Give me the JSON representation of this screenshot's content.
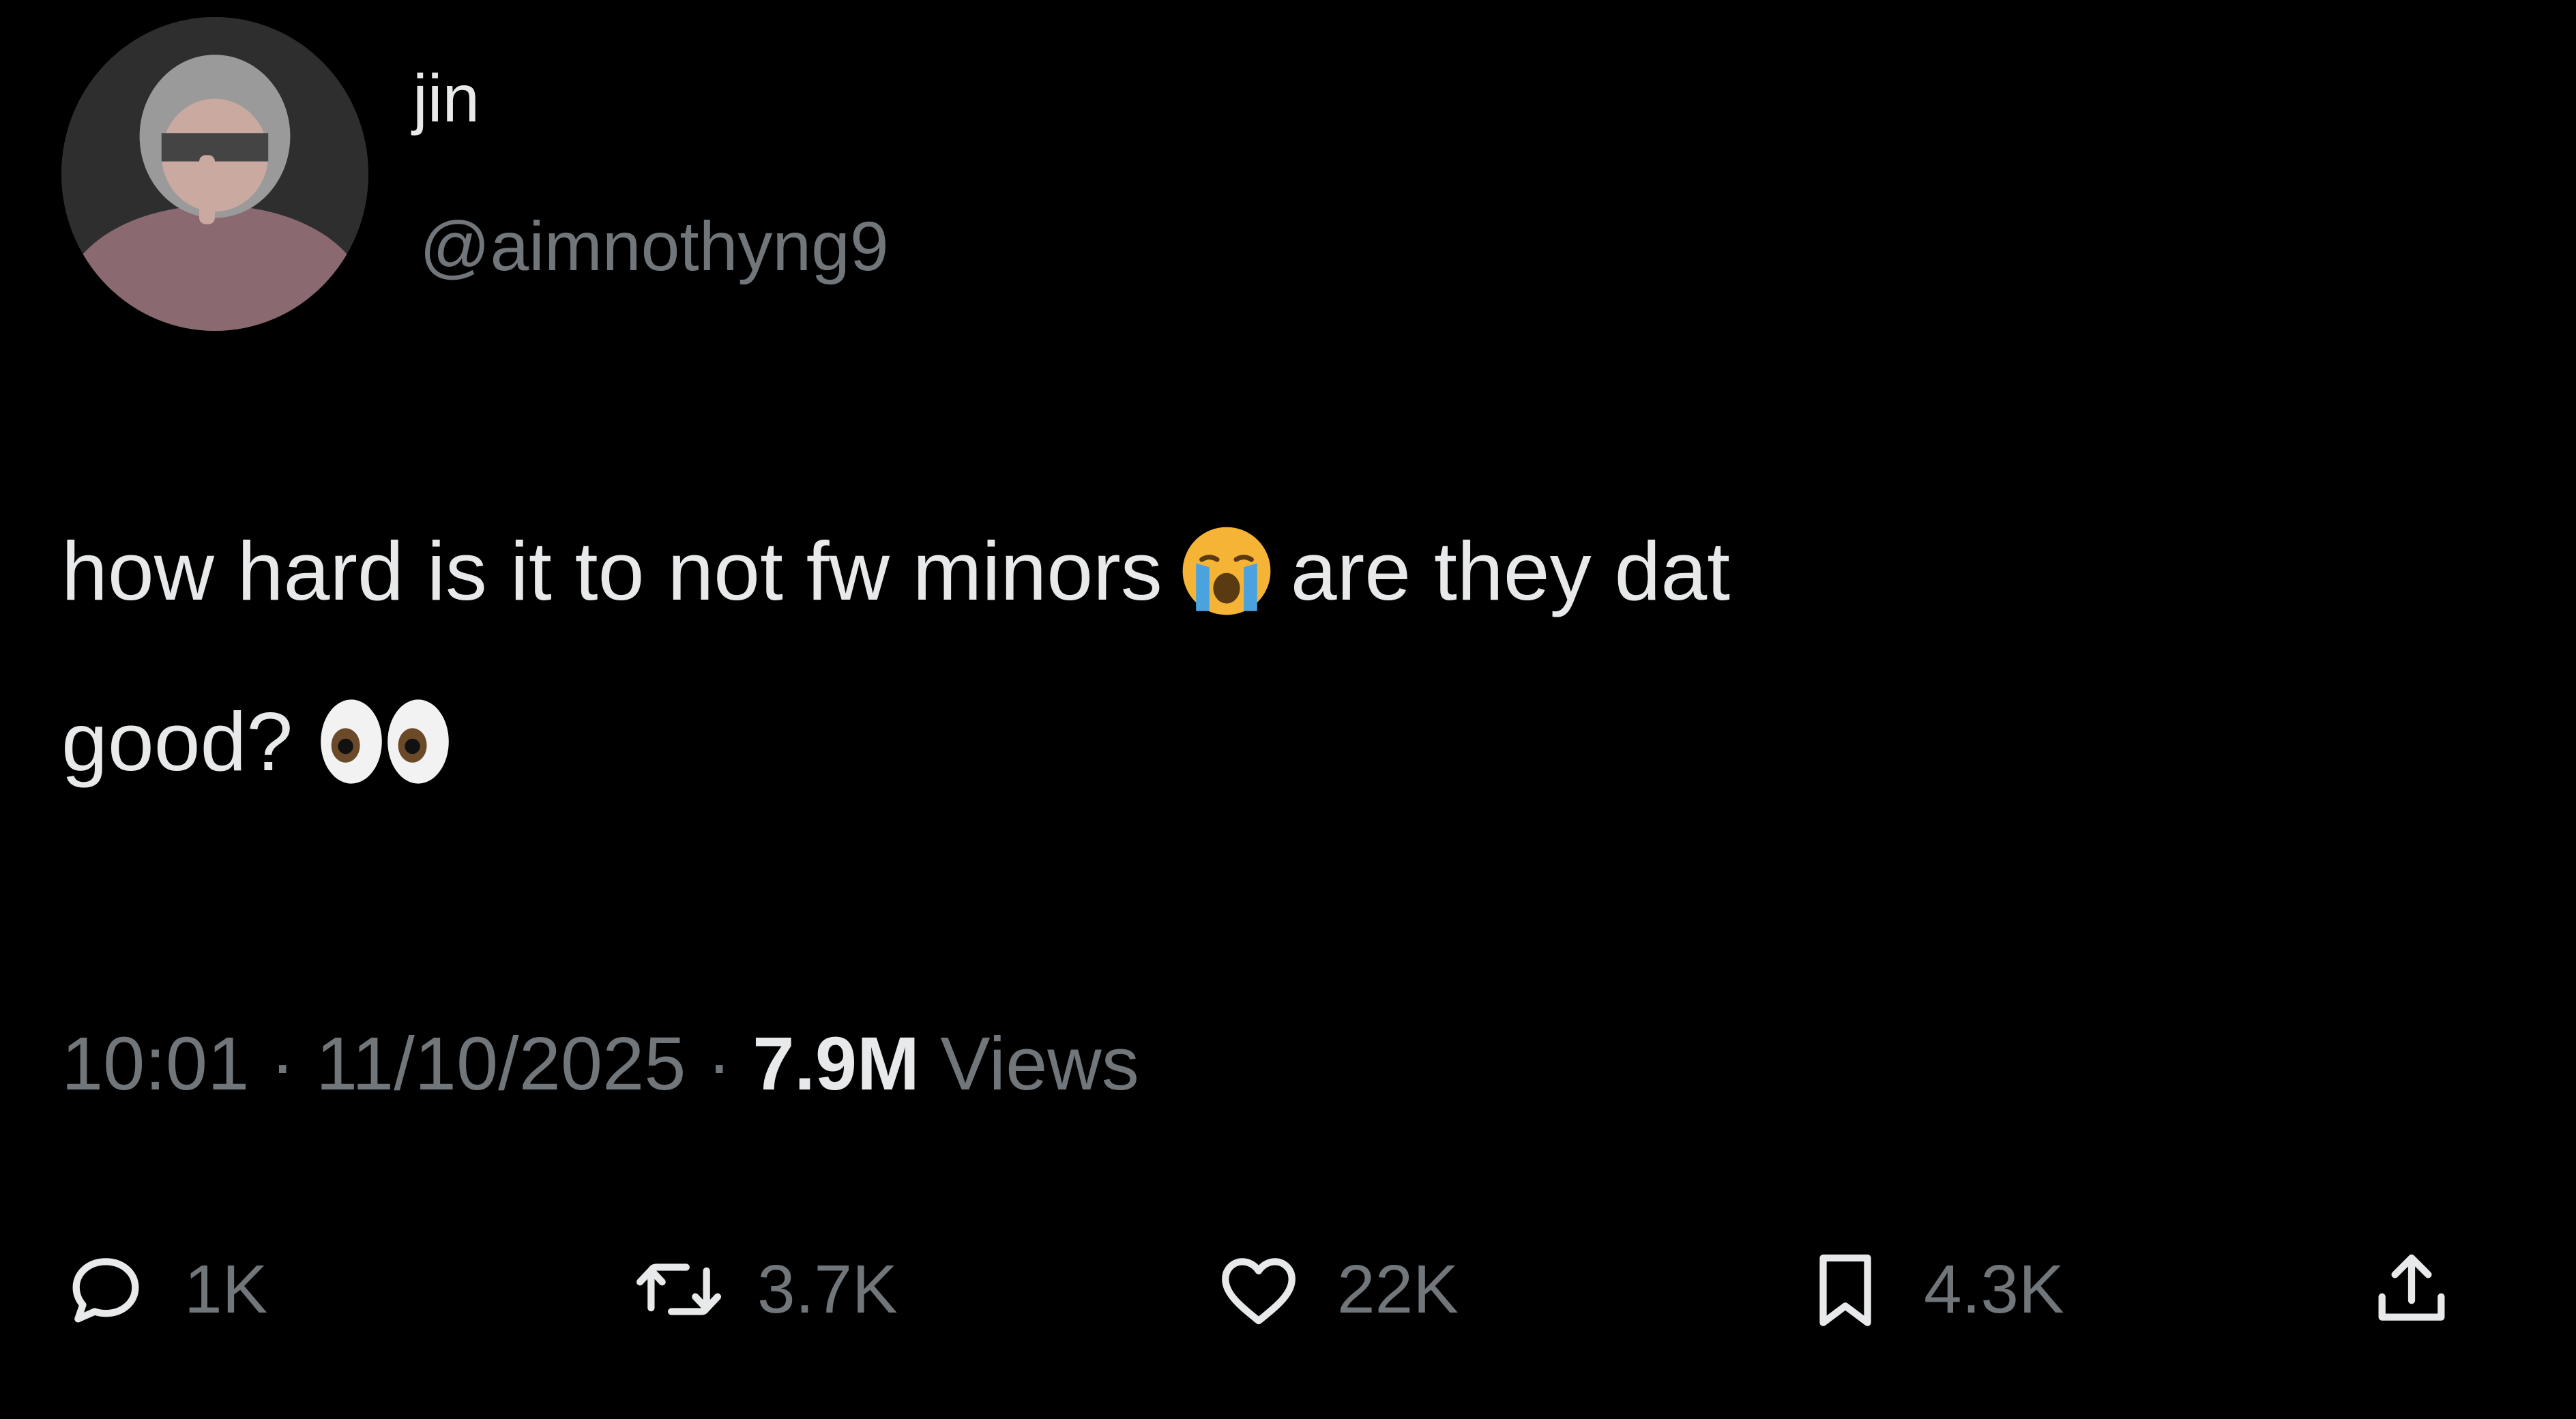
{
  "author": {
    "display_name": "jin",
    "handle": "@aimnothyng9"
  },
  "tweet": {
    "line1_part1": "how hard is it to not fw minors",
    "line1_part2": "are they dat",
    "line2": "good?",
    "emojis": [
      "loudly-crying-face",
      "eyes"
    ]
  },
  "meta": {
    "time": "10:01",
    "separator": "·",
    "date": "11/10/2025",
    "views_count": "7.9M",
    "views_label": "Views"
  },
  "actions": {
    "replies": "1K",
    "retweets": "3.7K",
    "likes": "22K",
    "bookmarks": "4.3K"
  },
  "colors": {
    "background": "#000000",
    "text_primary": "#e7e9ea",
    "text_secondary": "#71767b"
  },
  "icons": {
    "reply": "reply-icon",
    "retweet": "retweet-icon",
    "like": "heart-icon",
    "bookmark": "bookmark-icon",
    "share": "share-icon"
  }
}
